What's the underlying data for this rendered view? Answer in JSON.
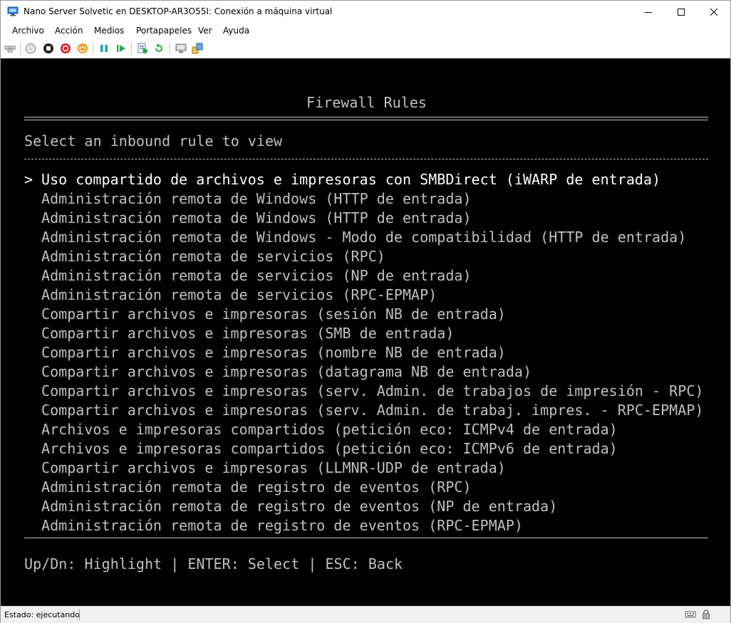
{
  "window": {
    "title": "Nano Server Solvetic en DESKTOP-AR3O55I: Conexión a máquina virtual",
    "minimize_icon": "minimize-icon",
    "maximize_icon": "maximize-icon",
    "close_icon": "close-icon"
  },
  "menu": {
    "items": [
      "Archivo",
      "Acción",
      "Medios",
      "Portapapeles",
      "Ver",
      "Ayuda"
    ]
  },
  "toolbar": {
    "buttons": [
      "ctrl-alt-del-icon",
      "start-icon",
      "turn-off-icon",
      "shut-down-icon",
      "power-icon",
      "pause-icon",
      "resume-icon",
      "checkpoint-icon",
      "revert-icon",
      "enhanced-session-icon",
      "share-icon"
    ],
    "colors": {
      "shutdown_red": "#d4202a",
      "power_orange": "#f39a1c",
      "pause_teal": "#1ba1c2",
      "resume_green": "#2aa84a"
    }
  },
  "console": {
    "background": "#000000",
    "text_color": "#c0c0c0",
    "highlight_color": "#ffffff",
    "heading": "Firewall Rules",
    "double_rule": "========================================================================================================================================================================================",
    "subheading": "Select an inbound rule to view",
    "single_rule": "-------------------------------------------------------------------------------------------------------------------------------------------------------------------------------",
    "selected_marker": ">",
    "rules": [
      "Uso compartido de archivos e impresoras con SMBDirect (iWARP de entrada)",
      "Administración remota de Windows (HTTP de entrada)",
      "Administración remota de Windows (HTTP de entrada)",
      "Administración remota de Windows - Modo de compatibilidad (HTTP de entrada)",
      "Administración remota de servicios (RPC)",
      "Administración remota de servicios (NP de entrada)",
      "Administración remota de servicios (RPC-EPMAP)",
      "Compartir archivos e impresoras (sesión NB de entrada)",
      "Compartir archivos e impresoras (SMB de entrada)",
      "Compartir archivos e impresoras (nombre NB de entrada)",
      "Compartir archivos e impresoras (datagrama NB de entrada)",
      "Compartir archivos e impresoras (serv. Admin. de trabajos de impresión - RPC)",
      "Compartir archivos e impresoras (serv. Admin. de trabaj. impres. - RPC-EPMAP)",
      "Archivos e impresoras compartidos (petición eco: ICMPv4 de entrada)",
      "Archivos e impresoras compartidos (petición eco: ICMPv6 de entrada)",
      "Compartir archivos e impresoras (LLMNR-UDP de entrada)",
      "Administración remota de registro de eventos (RPC)",
      "Administración remota de registro de eventos (NP de entrada)",
      "Administración remota de registro de eventos (RPC-EPMAP)"
    ],
    "selected_index": 0,
    "footer": "Up/Dn: Highlight | ENTER: Select | ESC: Back"
  },
  "status": {
    "text": "Estado: ejecutando",
    "icons": [
      "keyboard-icon",
      "lock-icon"
    ]
  }
}
